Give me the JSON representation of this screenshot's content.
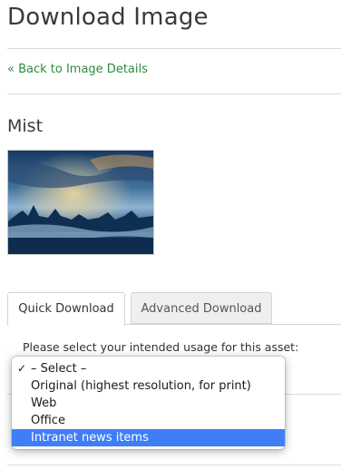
{
  "page_title": "Download Image",
  "back_link": "« Back to Image Details",
  "image_title": "Mist",
  "image_icon": "landscape-thumbnail-image",
  "tabs": [
    {
      "label": "Quick Download",
      "active": true
    },
    {
      "label": "Advanced Download",
      "active": false
    }
  ],
  "usage_prompt": "Please select your intended usage for this asset:",
  "dropdown": {
    "checked_index": 0,
    "highlighted_index": 4,
    "check_mark": "✓",
    "options": [
      "– Select –",
      "Original (highest resolution, for print)",
      "Web",
      "Office",
      "Intranet news items"
    ]
  },
  "colors": {
    "link": "#2f8a3c",
    "highlight": "#3f7ef6"
  }
}
